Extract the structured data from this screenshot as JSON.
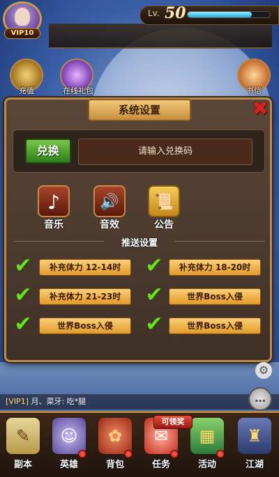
{
  "hud": {
    "vip_label": "VIP10",
    "level_label": "Lv.",
    "level_value": "50",
    "xp_fraction": 0.78,
    "side_icons": [
      {
        "label": "充值"
      },
      {
        "label": "在线礼包"
      },
      {
        "label": "书信"
      }
    ]
  },
  "dialog": {
    "title": "系统设置",
    "close_glyph": "✖",
    "redeem_button": "兑换",
    "redeem_placeholder": "请输入兑换码",
    "settings": [
      {
        "label": "音乐",
        "icon": "music-note-icon",
        "glyph": "♪"
      },
      {
        "label": "音效",
        "icon": "speaker-icon",
        "glyph": "🔊"
      },
      {
        "label": "公告",
        "icon": "scroll-notice-icon",
        "glyph": "📜"
      }
    ],
    "push_title": "推送设置",
    "push_options": [
      {
        "label": "补充体力 12-14时",
        "checked": true
      },
      {
        "label": "补充体力 18-20时",
        "checked": true
      },
      {
        "label": "补充体力 21-23时",
        "checked": true
      },
      {
        "label": "世界Boss入侵",
        "checked": true
      },
      {
        "label": "世界Boss入侵",
        "checked": true
      },
      {
        "label": "世界Boss入侵",
        "checked": true
      }
    ]
  },
  "chat": {
    "vip_tag": "[VIP1]",
    "message": " 月、菜牙: 吃*腿"
  },
  "bottom_nav": {
    "reward_tag": "可领奖",
    "items": [
      {
        "label": "副本",
        "icon": "map-scroll-icon",
        "badge": false
      },
      {
        "label": "英雄",
        "icon": "hero-portrait-icon",
        "badge": true
      },
      {
        "label": "背包",
        "icon": "bag-icon",
        "badge": true
      },
      {
        "label": "任务",
        "icon": "quest-gift-icon",
        "badge": true
      },
      {
        "label": "活动",
        "icon": "event-box-icon",
        "badge": true
      },
      {
        "label": "江湖",
        "icon": "tower-icon",
        "badge": false
      }
    ]
  },
  "colors": {
    "dialog_bg": "#4d3b2e",
    "dialog_border": "#b88a54",
    "push_button": "#f0b54a",
    "check": "#6fdc2a",
    "redeem_button": "#4fa02a",
    "close": "#d3241e"
  }
}
